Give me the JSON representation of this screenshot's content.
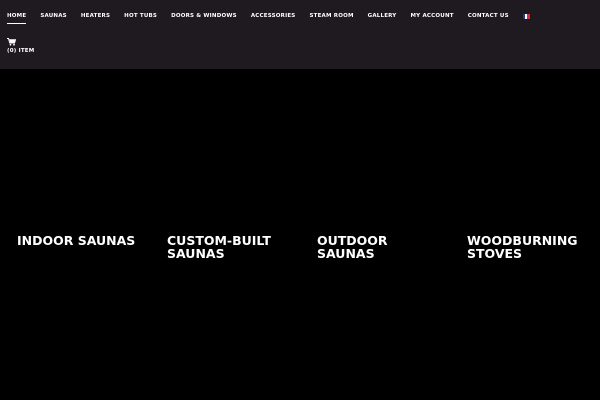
{
  "nav": {
    "items": [
      {
        "label": "HOME",
        "active": true
      },
      {
        "label": "SAUNAS",
        "active": false
      },
      {
        "label": "HEATERS",
        "active": false
      },
      {
        "label": "HOT TUBS",
        "active": false
      },
      {
        "label": "DOORS & WINDOWS",
        "active": false
      },
      {
        "label": "ACCESSORIES",
        "active": false
      },
      {
        "label": "STEAM ROOM",
        "active": false
      },
      {
        "label": "GALLERY",
        "active": false
      },
      {
        "label": "MY ACCOUNT",
        "active": false
      },
      {
        "label": "CONTACT US",
        "active": false
      }
    ],
    "language_flag": {
      "icon": "french-flag-icon",
      "colors": [
        "#1f3a93",
        "#ffffff",
        "#e32636"
      ]
    }
  },
  "cart": {
    "icon": "cart-icon",
    "label": "(0) ITEM"
  },
  "tiles": [
    {
      "line1": "INDOOR SAUNAS",
      "line2": ""
    },
    {
      "line1": "CUSTOM-BUILT",
      "line2": "SAUNAS"
    },
    {
      "line1": "OUTDOOR",
      "line2": "SAUNAS"
    },
    {
      "line1": "WOODBURNING",
      "line2": "STOVES"
    }
  ],
  "colors": {
    "header_bg": "#1e1a1f",
    "page_bg": "#000000",
    "text": "#ffffff"
  }
}
